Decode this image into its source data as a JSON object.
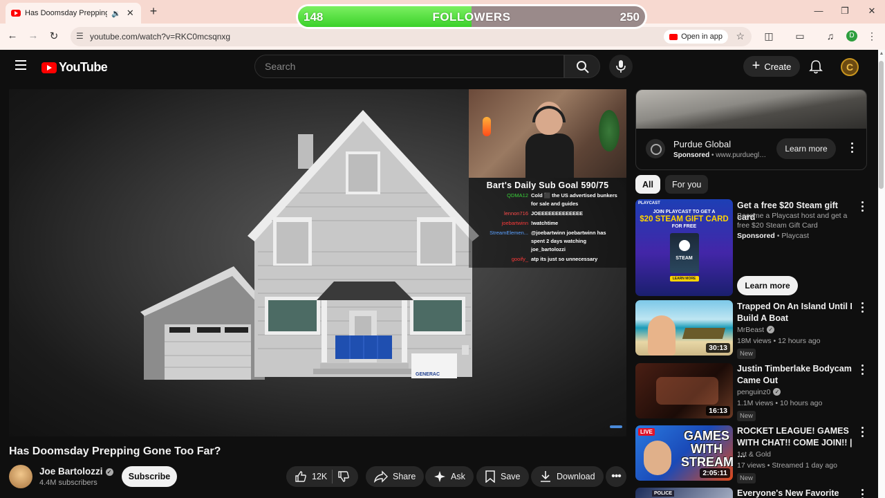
{
  "browser": {
    "tab_title": "Has Doomsday Prepping G",
    "new_tab": "+",
    "url": "youtube.com/watch?v=RKC0mcsqnxg",
    "open_in_app": "Open in app",
    "profile_initial": "D",
    "accent_color": "#f7d9d0"
  },
  "followers_overlay": {
    "current": "148",
    "label": "FOLLOWERS",
    "goal": "250",
    "progress_percent": 50
  },
  "youtube": {
    "logo_text": "YouTube",
    "search_placeholder": "Search",
    "create_label": "Create",
    "user_initial": "C",
    "brand_color": "#ff0000"
  },
  "video": {
    "title": "Has Doomsday Prepping Gone Too Far?",
    "channel": "Joe Bartolozzi",
    "subscribers": "4.4M subscribers",
    "subscribe_label": "Subscribe",
    "likes": "12K",
    "share_label": "Share",
    "ask_label": "Ask",
    "save_label": "Save",
    "download_label": "Download",
    "overlay": {
      "goal_text": "Bart's Daily Sub Goal 590/75",
      "generator_brand": "GENERAC",
      "chat": [
        {
          "user": "QDMA12",
          "color": "#3ad13a",
          "msg": "Cold ⬛ the US advertised bunkers for sale and guides"
        },
        {
          "user": "lennon716",
          "color": "#ff4b4b",
          "msg": "JOEEEEEEEEEEEEE"
        },
        {
          "user": "joebartwinn",
          "color": "#ff3a3a",
          "msg": "!watchtime"
        },
        {
          "user": "StreamElemen...",
          "color": "#5aa0ff",
          "msg": "@joebartwinn joebartwinn has spent 2 days watching joe_bartolozzi"
        },
        {
          "user": "gooify_",
          "color": "#ff3a3a",
          "msg": "atp its just so unnecessary"
        }
      ]
    }
  },
  "ad": {
    "advertiser": "Purdue Global",
    "sponsored": "Sponsored",
    "domain": "www.purduegl…",
    "learn_more": "Learn more"
  },
  "chips": [
    "All",
    "For you"
  ],
  "steam_ad": {
    "title": "Get a free $20 Steam gift card",
    "description": "Become a Playcast host and get a free $20 Steam Gift Card",
    "sponsored": "Sponsored",
    "advertiser": "Playcast",
    "learn_more": "Learn more",
    "thumb_tag": "PLAYCAST",
    "thumb_line1": "JOIN PLAYCAST TO GET A",
    "thumb_line2": "$20 STEAM GIFT CARD",
    "thumb_line3": "FOR FREE",
    "thumb_card": "STEAM",
    "thumb_button": "LEARN MORE"
  },
  "recommendations": [
    {
      "title": "Trapped On An Island Until I Build A Boat",
      "channel": "MrBeast",
      "verified": true,
      "stats": "18M views • 12 hours ago",
      "badge": "New",
      "duration": "30:13"
    },
    {
      "title": "Justin Timberlake Bodycam Came Out",
      "channel": "penguinz0",
      "verified": true,
      "stats": "1.1M views • 10 hours ago",
      "badge": "New",
      "duration": "16:13"
    },
    {
      "title": "ROCKET LEAGUE! GAMES WITH CHAT!! COME JOIN!! | …",
      "channel": "1st & Gold",
      "verified": false,
      "stats": "17 views • Streamed 1 day ago",
      "badge": "New",
      "duration": "2:05:11",
      "live_tag": "LIVE",
      "thumb_text": "GAMES WITH STREAM!"
    },
    {
      "title": "Everyone's New Favorite Game...",
      "thumb_text": "POLICE"
    }
  ]
}
